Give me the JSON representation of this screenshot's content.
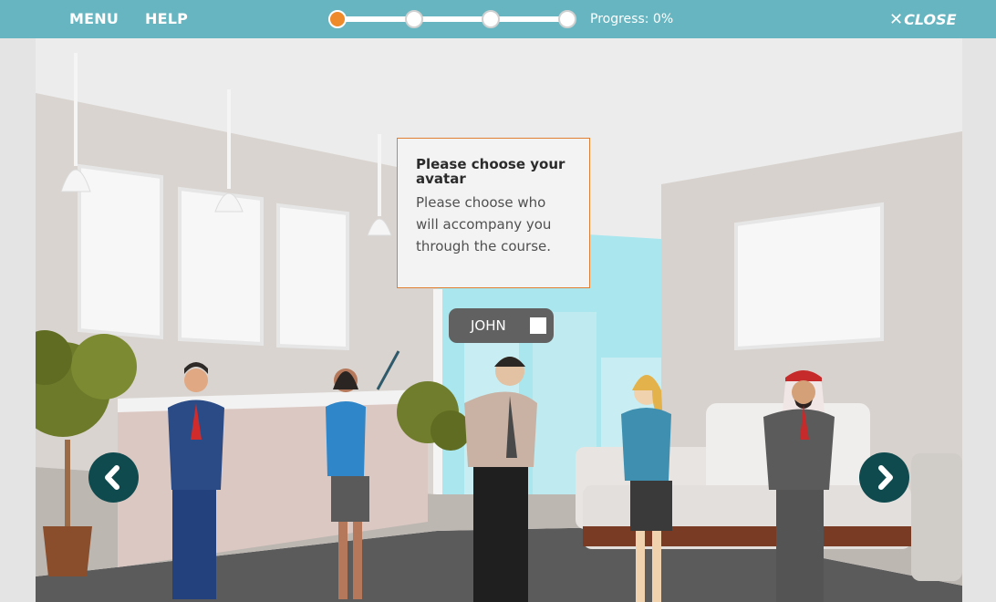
{
  "topbar": {
    "menu_label": "MENU",
    "help_label": "HELP",
    "progress_text": "Progress: 0%",
    "progress_value": 0,
    "steps_total": 4,
    "current_step": 1,
    "close_label": "CLOSE",
    "close_icon": "close-x-icon"
  },
  "dialog": {
    "title": "Please choose your avatar",
    "body": "Please choose who will accompany you through the course."
  },
  "avatar_selector": {
    "name": "JOHN",
    "checked": false
  },
  "nav": {
    "prev_icon": "chevron-left-icon",
    "next_icon": "chevron-right-icon"
  },
  "colors": {
    "header": "#66b5c0",
    "accent": "#ee8a2a",
    "arrow_button": "#0f4a4f"
  }
}
